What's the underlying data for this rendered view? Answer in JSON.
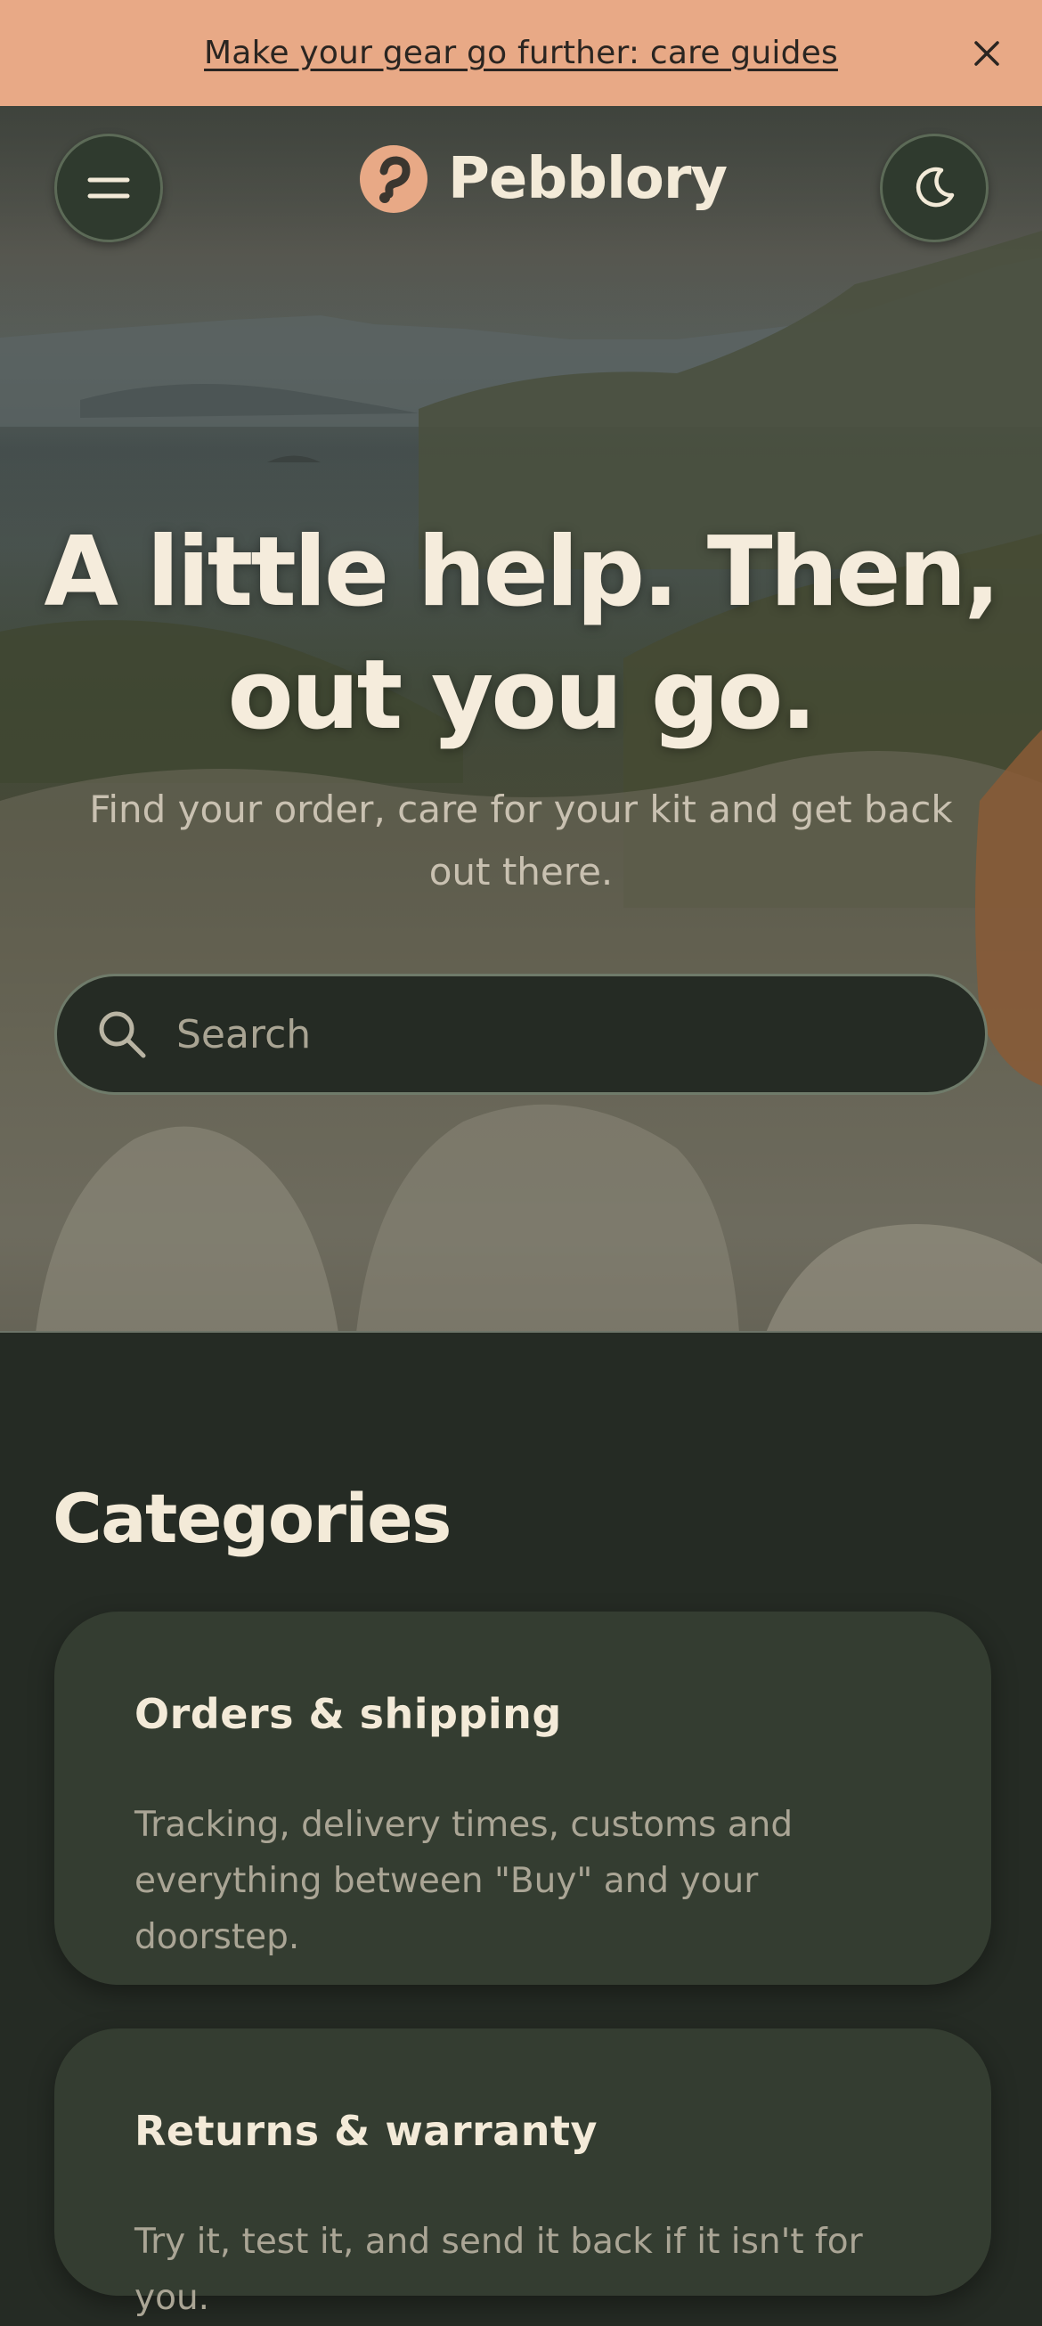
{
  "banner": {
    "link_text": "Make your gear go further: care guides",
    "close_icon": "close-icon"
  },
  "header": {
    "brand": "Pebblory",
    "menu_icon": "hamburger-menu-icon",
    "theme_icon": "moon-icon",
    "logo_icon": "pebble-logo-icon"
  },
  "hero": {
    "title_line1": "A little help. Then,",
    "title_line2": "out you go.",
    "subtitle": "Find your order, care for your kit and get back out there.",
    "search": {
      "placeholder": "Search",
      "value": "",
      "icon": "search-icon"
    }
  },
  "categories": {
    "heading": "Categories",
    "items": [
      {
        "title": "Orders & shipping",
        "description": "Tracking, delivery times, customs and everything between \"Buy\" and your doorstep."
      },
      {
        "title": "Returns & warranty",
        "description": "Try it, test it, and send it back if it isn't for you."
      }
    ]
  },
  "colors": {
    "banner": "#e8a986",
    "background": "#252b24",
    "card": "#343d31",
    "accent": "#e8a986",
    "text_light": "#f3ead8"
  }
}
